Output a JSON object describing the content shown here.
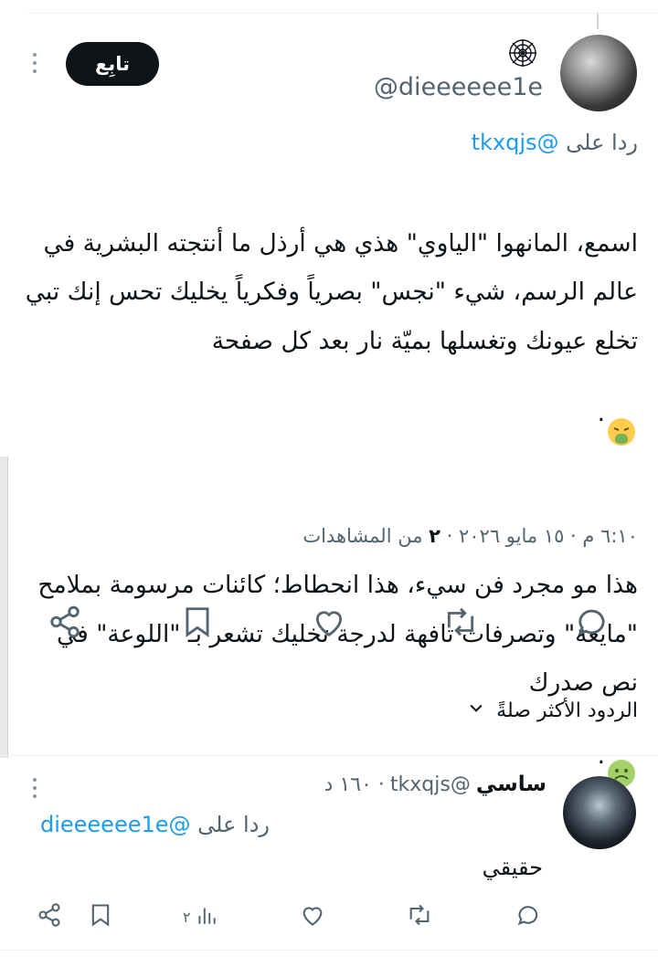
{
  "tweet": {
    "handle": "@dieeeeee1e",
    "follow_label": "تابِع",
    "reply_prefix": "ردا على",
    "reply_mention": "@tkxqjs",
    "text_part1": "اسمع، المانهوا \"الياوي\" هذي هي أرذل ما أنتجته البشرية في عالم الرسم، شيء \"نجس\" بصرياً وفكرياً يخليك تحس إنك تبي تخلع عيونك وتغسلها بميّة نار بعد كل صفحة",
    "text_part2": "هذا مو مجرد فن سيء، هذا انحطاط؛ كائنات مرسومة بملامح \"مايعة\" وتصرفات تافهة لدرجة تخليك تشعر بـ \"اللوعة\" في نص صدرك",
    "emoji1": "vomiting-face",
    "emoji2": "nauseated-face",
    "timestamp": "٦:١٠ م · ١٥ مايو ٢٠٢٦ · ",
    "views_count": "٢",
    "views_label": " من المشاهدات"
  },
  "actions": [
    "share-icon",
    "bookmark-icon",
    "like-icon",
    "retweet-icon",
    "reply-icon"
  ],
  "sort": {
    "label": "الردود الأكثر صلةً"
  },
  "reply": {
    "name": "ساسي",
    "handle": "@tkxqjs",
    "time": " · ١٦٠ د",
    "reply_prefix": "ردا على",
    "reply_mention": "@dieeeeee1e",
    "text": "حقيقي",
    "views_count": "٢"
  },
  "colors": {
    "accent": "#1d9bf0",
    "text": "#0f1419",
    "muted": "#536471"
  }
}
